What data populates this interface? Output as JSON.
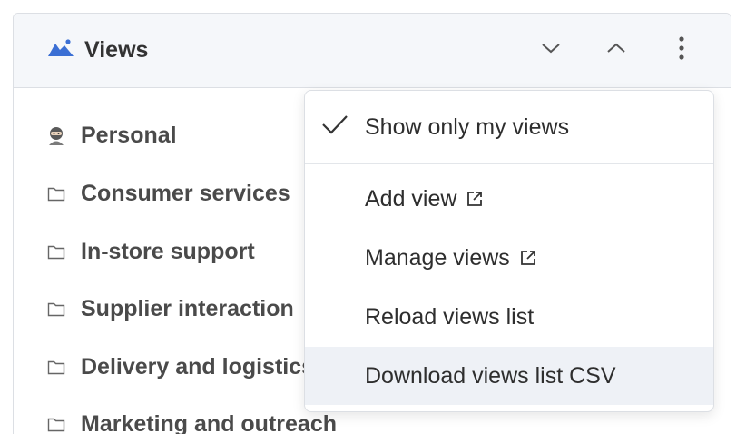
{
  "header": {
    "title": "Views",
    "icons": {
      "title": "mountain-chart-icon",
      "collapse_down": "chevron-down-icon",
      "collapse_up": "chevron-up-icon",
      "more": "kebab-menu-icon"
    },
    "accent": "#3b6fd4"
  },
  "views": [
    {
      "label": "Personal",
      "icon": "ninja-avatar-icon"
    },
    {
      "label": "Consumer services",
      "icon": "folder-icon"
    },
    {
      "label": "In-store support",
      "icon": "folder-icon"
    },
    {
      "label": "Supplier interaction",
      "icon": "folder-icon"
    },
    {
      "label": "Delivery and logistics",
      "icon": "folder-icon"
    },
    {
      "label": "Marketing and outreach",
      "icon": "folder-icon"
    }
  ],
  "menu": {
    "show_only_mine": {
      "label": "Show only my views",
      "checked": true
    },
    "add_view": {
      "label": "Add view",
      "icon": "external-link-icon"
    },
    "manage_views": {
      "label": "Manage views",
      "icon": "external-link-icon"
    },
    "reload": {
      "label": "Reload views list"
    },
    "download_csv": {
      "label": "Download views list CSV",
      "highlighted": true
    }
  }
}
